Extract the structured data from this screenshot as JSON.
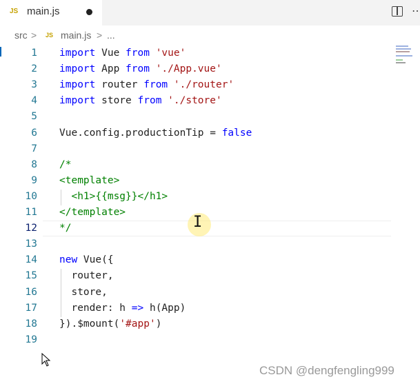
{
  "tab": {
    "badge": "JS",
    "title": "main.js"
  },
  "breadcrumb": {
    "folder": "src",
    "sep": ">",
    "badge": "JS",
    "file": "main.js",
    "ellipsis": "..."
  },
  "lines": [
    {
      "n": "1",
      "tokens": [
        [
          "kw",
          "import"
        ],
        [
          "plain",
          " Vue "
        ],
        [
          "kw",
          "from"
        ],
        [
          "plain",
          " "
        ],
        [
          "str",
          "'vue'"
        ]
      ]
    },
    {
      "n": "2",
      "tokens": [
        [
          "kw",
          "import"
        ],
        [
          "plain",
          " App "
        ],
        [
          "kw",
          "from"
        ],
        [
          "plain",
          " "
        ],
        [
          "str",
          "'./App.vue'"
        ]
      ]
    },
    {
      "n": "3",
      "tokens": [
        [
          "kw",
          "import"
        ],
        [
          "plain",
          " router "
        ],
        [
          "kw",
          "from"
        ],
        [
          "plain",
          " "
        ],
        [
          "str",
          "'./router'"
        ]
      ]
    },
    {
      "n": "4",
      "tokens": [
        [
          "kw",
          "import"
        ],
        [
          "plain",
          " store "
        ],
        [
          "kw",
          "from"
        ],
        [
          "plain",
          " "
        ],
        [
          "str",
          "'./store'"
        ]
      ]
    },
    {
      "n": "5",
      "tokens": []
    },
    {
      "n": "6",
      "tokens": [
        [
          "plain",
          "Vue.config.productionTip = "
        ],
        [
          "kw",
          "false"
        ]
      ]
    },
    {
      "n": "7",
      "tokens": []
    },
    {
      "n": "8",
      "tokens": [
        [
          "cmt",
          "/*"
        ]
      ]
    },
    {
      "n": "9",
      "tokens": [
        [
          "cmt",
          "<template>"
        ]
      ]
    },
    {
      "n": "10",
      "tokens": [
        [
          "cmt",
          "  <h1>{{msg}}</h1>"
        ]
      ]
    },
    {
      "n": "11",
      "tokens": [
        [
          "cmt",
          "</template>"
        ]
      ]
    },
    {
      "n": "12",
      "tokens": [
        [
          "cmt",
          "*/"
        ]
      ]
    },
    {
      "n": "13",
      "tokens": []
    },
    {
      "n": "14",
      "tokens": [
        [
          "kw",
          "new"
        ],
        [
          "plain",
          " Vue({"
        ]
      ]
    },
    {
      "n": "15",
      "tokens": [
        [
          "plain",
          "  router,"
        ]
      ]
    },
    {
      "n": "16",
      "tokens": [
        [
          "plain",
          "  store,"
        ]
      ]
    },
    {
      "n": "17",
      "tokens": [
        [
          "plain",
          "  render: h "
        ],
        [
          "kw",
          "=>"
        ],
        [
          "plain",
          " h(App)"
        ]
      ]
    },
    {
      "n": "18",
      "tokens": [
        [
          "plain",
          "}).$mount("
        ],
        [
          "str",
          "'#app'"
        ],
        [
          "plain",
          ")"
        ]
      ]
    },
    {
      "n": "19",
      "tokens": []
    }
  ],
  "active_line": "12",
  "watermark": "CSDN @dengfengling999",
  "colors": {
    "keyword": "#0000ff",
    "string": "#a31515",
    "comment": "#008000",
    "line_number": "#237893"
  },
  "icons": {
    "split": "split-editor-icon",
    "more": "more-actions-icon",
    "cursor": "text-cursor-icon",
    "pointer": "mouse-pointer-icon"
  }
}
